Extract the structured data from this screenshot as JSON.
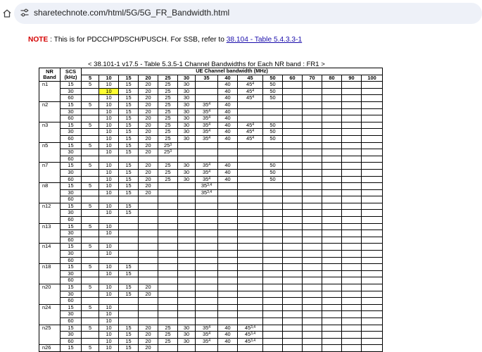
{
  "browser": {
    "url": "sharetechnote.com/html/5G/5G_FR_Bandwidth.html"
  },
  "note": {
    "label": "NOTE",
    "text": " : This is for PDCCH/PDSCH/PUSCH. For SSB, refer to ",
    "link": "38.104 - Table 5.4.3.3-1"
  },
  "table": {
    "caption": "< 38.101-1 v17.5 - Table 5.3.5-1 Channel Bandwidths for Each NR band : FR1 >",
    "header": {
      "band": [
        "NR",
        "Band"
      ],
      "scs": [
        "SCS",
        "(kHz)"
      ],
      "group": "UE Channel bandwidth (MHz)",
      "bandwidths": [
        "5",
        "10",
        "15",
        "20",
        "25",
        "30",
        "35",
        "40",
        "45",
        "50",
        "60",
        "70",
        "80",
        "90",
        "100"
      ]
    },
    "bands": [
      {
        "band": "n1",
        "rows": [
          {
            "scs": "15",
            "cells": [
              "5",
              "10",
              "15",
              "20",
              "25",
              "30",
              "",
              "40",
              "45|4",
              "50",
              "",
              "",
              "",
              "",
              ""
            ]
          },
          {
            "scs": "30",
            "cells": [
              "",
              "10",
              "15",
              "20",
              "25",
              "30",
              "",
              "40",
              "45|4",
              "50",
              "",
              "",
              "",
              "",
              ""
            ]
          },
          {
            "scs": "60",
            "cells": [
              "",
              "10",
              "15",
              "20",
              "25",
              "30",
              "",
              "40",
              "45|4",
              "50",
              "",
              "",
              "",
              "",
              ""
            ]
          }
        ]
      },
      {
        "band": "n2",
        "rows": [
          {
            "scs": "15",
            "cells": [
              "5",
              "10",
              "15",
              "20",
              "25",
              "30",
              "35|4",
              "40",
              "",
              "",
              "",
              "",
              "",
              "",
              ""
            ]
          },
          {
            "scs": "30",
            "cells": [
              "",
              "10",
              "15",
              "20",
              "25",
              "30",
              "35|4",
              "40",
              "",
              "",
              "",
              "",
              "",
              "",
              ""
            ]
          },
          {
            "scs": "60",
            "cells": [
              "",
              "10",
              "15",
              "20",
              "25",
              "30",
              "35|4",
              "40",
              "",
              "",
              "",
              "",
              "",
              "",
              ""
            ]
          }
        ]
      },
      {
        "band": "n3",
        "rows": [
          {
            "scs": "15",
            "cells": [
              "5",
              "10",
              "15",
              "20",
              "25",
              "30",
              "35|4",
              "40",
              "45|4",
              "50",
              "",
              "",
              "",
              "",
              ""
            ]
          },
          {
            "scs": "30",
            "cells": [
              "",
              "10",
              "15",
              "20",
              "25",
              "30",
              "35|4",
              "40",
              "45|4",
              "50",
              "",
              "",
              "",
              "",
              ""
            ]
          },
          {
            "scs": "60",
            "cells": [
              "",
              "10",
              "15",
              "20",
              "25",
              "30",
              "35|4",
              "40",
              "45|4",
              "50",
              "",
              "",
              "",
              "",
              ""
            ]
          }
        ]
      },
      {
        "band": "n5",
        "rows": [
          {
            "scs": "15",
            "cells": [
              "5",
              "10",
              "15",
              "20",
              "25|3",
              "",
              "",
              "",
              "",
              "",
              "",
              "",
              "",
              "",
              ""
            ]
          },
          {
            "scs": "30",
            "cells": [
              "",
              "10",
              "15",
              "20",
              "25|3",
              "",
              "",
              "",
              "",
              "",
              "",
              "",
              "",
              "",
              ""
            ]
          },
          {
            "scs": "60",
            "cells": [
              "",
              "",
              "",
              "",
              "",
              "",
              "",
              "",
              "",
              "",
              "",
              "",
              "",
              "",
              ""
            ]
          }
        ]
      },
      {
        "band": "n7",
        "rows": [
          {
            "scs": "15",
            "cells": [
              "5",
              "10",
              "15",
              "20",
              "25",
              "30",
              "35|4",
              "40",
              "",
              "50",
              "",
              "",
              "",
              "",
              ""
            ]
          },
          {
            "scs": "30",
            "cells": [
              "",
              "10",
              "15",
              "20",
              "25",
              "30",
              "35|4",
              "40",
              "",
              "50",
              "",
              "",
              "",
              "",
              ""
            ]
          },
          {
            "scs": "60",
            "cells": [
              "",
              "10",
              "15",
              "20",
              "25",
              "30",
              "35|4",
              "40",
              "",
              "50",
              "",
              "",
              "",
              "",
              ""
            ]
          }
        ]
      },
      {
        "band": "n8",
        "rows": [
          {
            "scs": "15",
            "cells": [
              "5",
              "10",
              "15",
              "20",
              "",
              "",
              "35|3,4",
              "",
              "",
              "",
              "",
              "",
              "",
              "",
              ""
            ]
          },
          {
            "scs": "30",
            "cells": [
              "",
              "10",
              "15",
              "20",
              "",
              "",
              "35|3,4",
              "",
              "",
              "",
              "",
              "",
              "",
              "",
              ""
            ]
          },
          {
            "scs": "60",
            "cells": [
              "",
              "",
              "",
              "",
              "",
              "",
              "",
              "",
              "",
              "",
              "",
              "",
              "",
              "",
              ""
            ]
          }
        ]
      },
      {
        "band": "n12",
        "rows": [
          {
            "scs": "15",
            "cells": [
              "5",
              "10",
              "15",
              "",
              "",
              "",
              "",
              "",
              "",
              "",
              "",
              "",
              "",
              "",
              ""
            ]
          },
          {
            "scs": "30",
            "cells": [
              "",
              "10",
              "15",
              "",
              "",
              "",
              "",
              "",
              "",
              "",
              "",
              "",
              "",
              "",
              ""
            ]
          },
          {
            "scs": "60",
            "cells": [
              "",
              "",
              "",
              "",
              "",
              "",
              "",
              "",
              "",
              "",
              "",
              "",
              "",
              "",
              ""
            ]
          }
        ]
      },
      {
        "band": "n13",
        "rows": [
          {
            "scs": "15",
            "cells": [
              "5",
              "10",
              "",
              "",
              "",
              "",
              "",
              "",
              "",
              "",
              "",
              "",
              "",
              "",
              ""
            ]
          },
          {
            "scs": "30",
            "cells": [
              "",
              "10",
              "",
              "",
              "",
              "",
              "",
              "",
              "",
              "",
              "",
              "",
              "",
              "",
              ""
            ]
          },
          {
            "scs": "60",
            "cells": [
              "",
              "",
              "",
              "",
              "",
              "",
              "",
              "",
              "",
              "",
              "",
              "",
              "",
              "",
              ""
            ]
          }
        ]
      },
      {
        "band": "n14",
        "rows": [
          {
            "scs": "15",
            "cells": [
              "5",
              "10",
              "",
              "",
              "",
              "",
              "",
              "",
              "",
              "",
              "",
              "",
              "",
              "",
              ""
            ]
          },
          {
            "scs": "30",
            "cells": [
              "",
              "10",
              "",
              "",
              "",
              "",
              "",
              "",
              "",
              "",
              "",
              "",
              "",
              "",
              ""
            ]
          },
          {
            "scs": "60",
            "cells": [
              "",
              "",
              "",
              "",
              "",
              "",
              "",
              "",
              "",
              "",
              "",
              "",
              "",
              "",
              ""
            ]
          }
        ]
      },
      {
        "band": "n18",
        "rows": [
          {
            "scs": "15",
            "cells": [
              "5",
              "10",
              "15",
              "",
              "",
              "",
              "",
              "",
              "",
              "",
              "",
              "",
              "",
              "",
              ""
            ]
          },
          {
            "scs": "30",
            "cells": [
              "",
              "10",
              "15",
              "",
              "",
              "",
              "",
              "",
              "",
              "",
              "",
              "",
              "",
              "",
              ""
            ]
          },
          {
            "scs": "60",
            "cells": [
              "",
              "",
              "",
              "",
              "",
              "",
              "",
              "",
              "",
              "",
              "",
              "",
              "",
              "",
              ""
            ]
          }
        ]
      },
      {
        "band": "n20",
        "rows": [
          {
            "scs": "15",
            "cells": [
              "5",
              "10",
              "15",
              "20",
              "",
              "",
              "",
              "",
              "",
              "",
              "",
              "",
              "",
              "",
              ""
            ]
          },
          {
            "scs": "30",
            "cells": [
              "",
              "10",
              "15",
              "20",
              "",
              "",
              "",
              "",
              "",
              "",
              "",
              "",
              "",
              "",
              ""
            ]
          },
          {
            "scs": "60",
            "cells": [
              "",
              "",
              "",
              "",
              "",
              "",
              "",
              "",
              "",
              "",
              "",
              "",
              "",
              "",
              ""
            ]
          }
        ]
      },
      {
        "band": "n24",
        "rows": [
          {
            "scs": "15",
            "cells": [
              "5",
              "10",
              "",
              "",
              "",
              "",
              "",
              "",
              "",
              "",
              "",
              "",
              "",
              "",
              ""
            ]
          },
          {
            "scs": "30",
            "cells": [
              "",
              "10",
              "",
              "",
              "",
              "",
              "",
              "",
              "",
              "",
              "",
              "",
              "",
              "",
              ""
            ]
          },
          {
            "scs": "60",
            "cells": [
              "",
              "10",
              "",
              "",
              "",
              "",
              "",
              "",
              "",
              "",
              "",
              "",
              "",
              "",
              ""
            ]
          }
        ]
      },
      {
        "band": "n25",
        "rows": [
          {
            "scs": "15",
            "cells": [
              "5",
              "10",
              "15",
              "20",
              "25",
              "30",
              "35|4",
              "40",
              "45|3,4",
              "",
              "",
              "",
              "",
              "",
              ""
            ]
          },
          {
            "scs": "30",
            "cells": [
              "",
              "10",
              "15",
              "20",
              "25",
              "30",
              "35|4",
              "40",
              "45|3,4",
              "",
              "",
              "",
              "",
              "",
              ""
            ]
          },
          {
            "scs": "60",
            "cells": [
              "",
              "10",
              "15",
              "20",
              "25",
              "30",
              "35|4",
              "40",
              "45|3,4",
              "",
              "",
              "",
              "",
              "",
              ""
            ]
          }
        ]
      },
      {
        "band": "n26",
        "rows": [
          {
            "scs": "15",
            "cells": [
              "5",
              "10",
              "15",
              "20",
              "",
              "",
              "",
              "",
              "",
              "",
              "",
              "",
              "",
              "",
              ""
            ]
          }
        ]
      }
    ],
    "highlight": {
      "band_index": 0,
      "row_index": 1,
      "col_index": 1,
      "color": "#ffff33"
    }
  }
}
